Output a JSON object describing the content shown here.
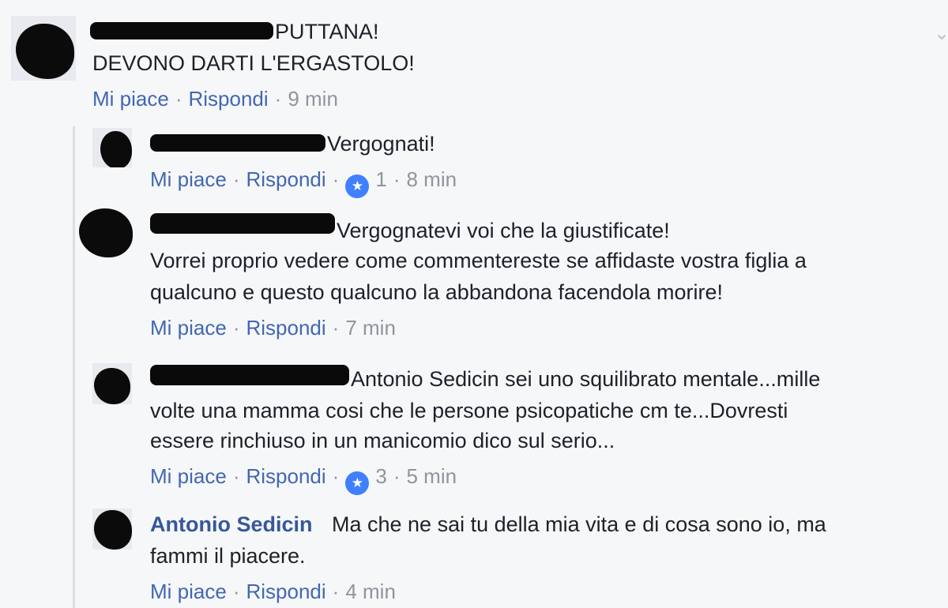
{
  "comments": [
    {
      "text_lines": [
        "PUTTANA!",
        "DEVONO DARTI L'ERGASTOLO!"
      ],
      "actions": {
        "like": "Mi piace",
        "reply": "Rispondi",
        "time": "9 min"
      }
    }
  ],
  "replies": [
    {
      "text_lines": [
        "Vergognati!"
      ],
      "actions": {
        "like": "Mi piace",
        "reply": "Rispondi",
        "likes": "1",
        "time": "8 min"
      }
    },
    {
      "text_lines": [
        "Vergognatevi voi che la giustificate!",
        "Vorrei proprio vedere come commentereste se affidaste vostra figlia a",
        "qualcuno e questo qualcuno la abbandona facendola morire!"
      ],
      "actions": {
        "like": "Mi piace",
        "reply": "Rispondi",
        "time": "7 min"
      }
    },
    {
      "text_lines": [
        "Antonio Sedicin sei uno squilibrato mentale...mille",
        "volte una mamma cosi che le persone psicopatiche cm te...Dovresti",
        "essere rinchiuso in un manicomio dico sul serio..."
      ],
      "actions": {
        "like": "Mi piace",
        "reply": "Rispondi",
        "likes": "3",
        "time": "5 min"
      }
    },
    {
      "author": "Antonio Sedicin",
      "text_lines": [
        "Ma che ne sai tu della mia vita e di cosa sono io, ma",
        "fammi il piacere."
      ],
      "actions": {
        "like": "Mi piace",
        "reply": "Rispondi",
        "time": "4 min"
      }
    }
  ],
  "icons": {
    "like_badge": "thumbs-up-icon",
    "options": "chevron-down-icon"
  },
  "colors": {
    "link": "#4267b2",
    "name": "#365899",
    "meta": "#90949c",
    "like_badge": "#4080ff"
  }
}
